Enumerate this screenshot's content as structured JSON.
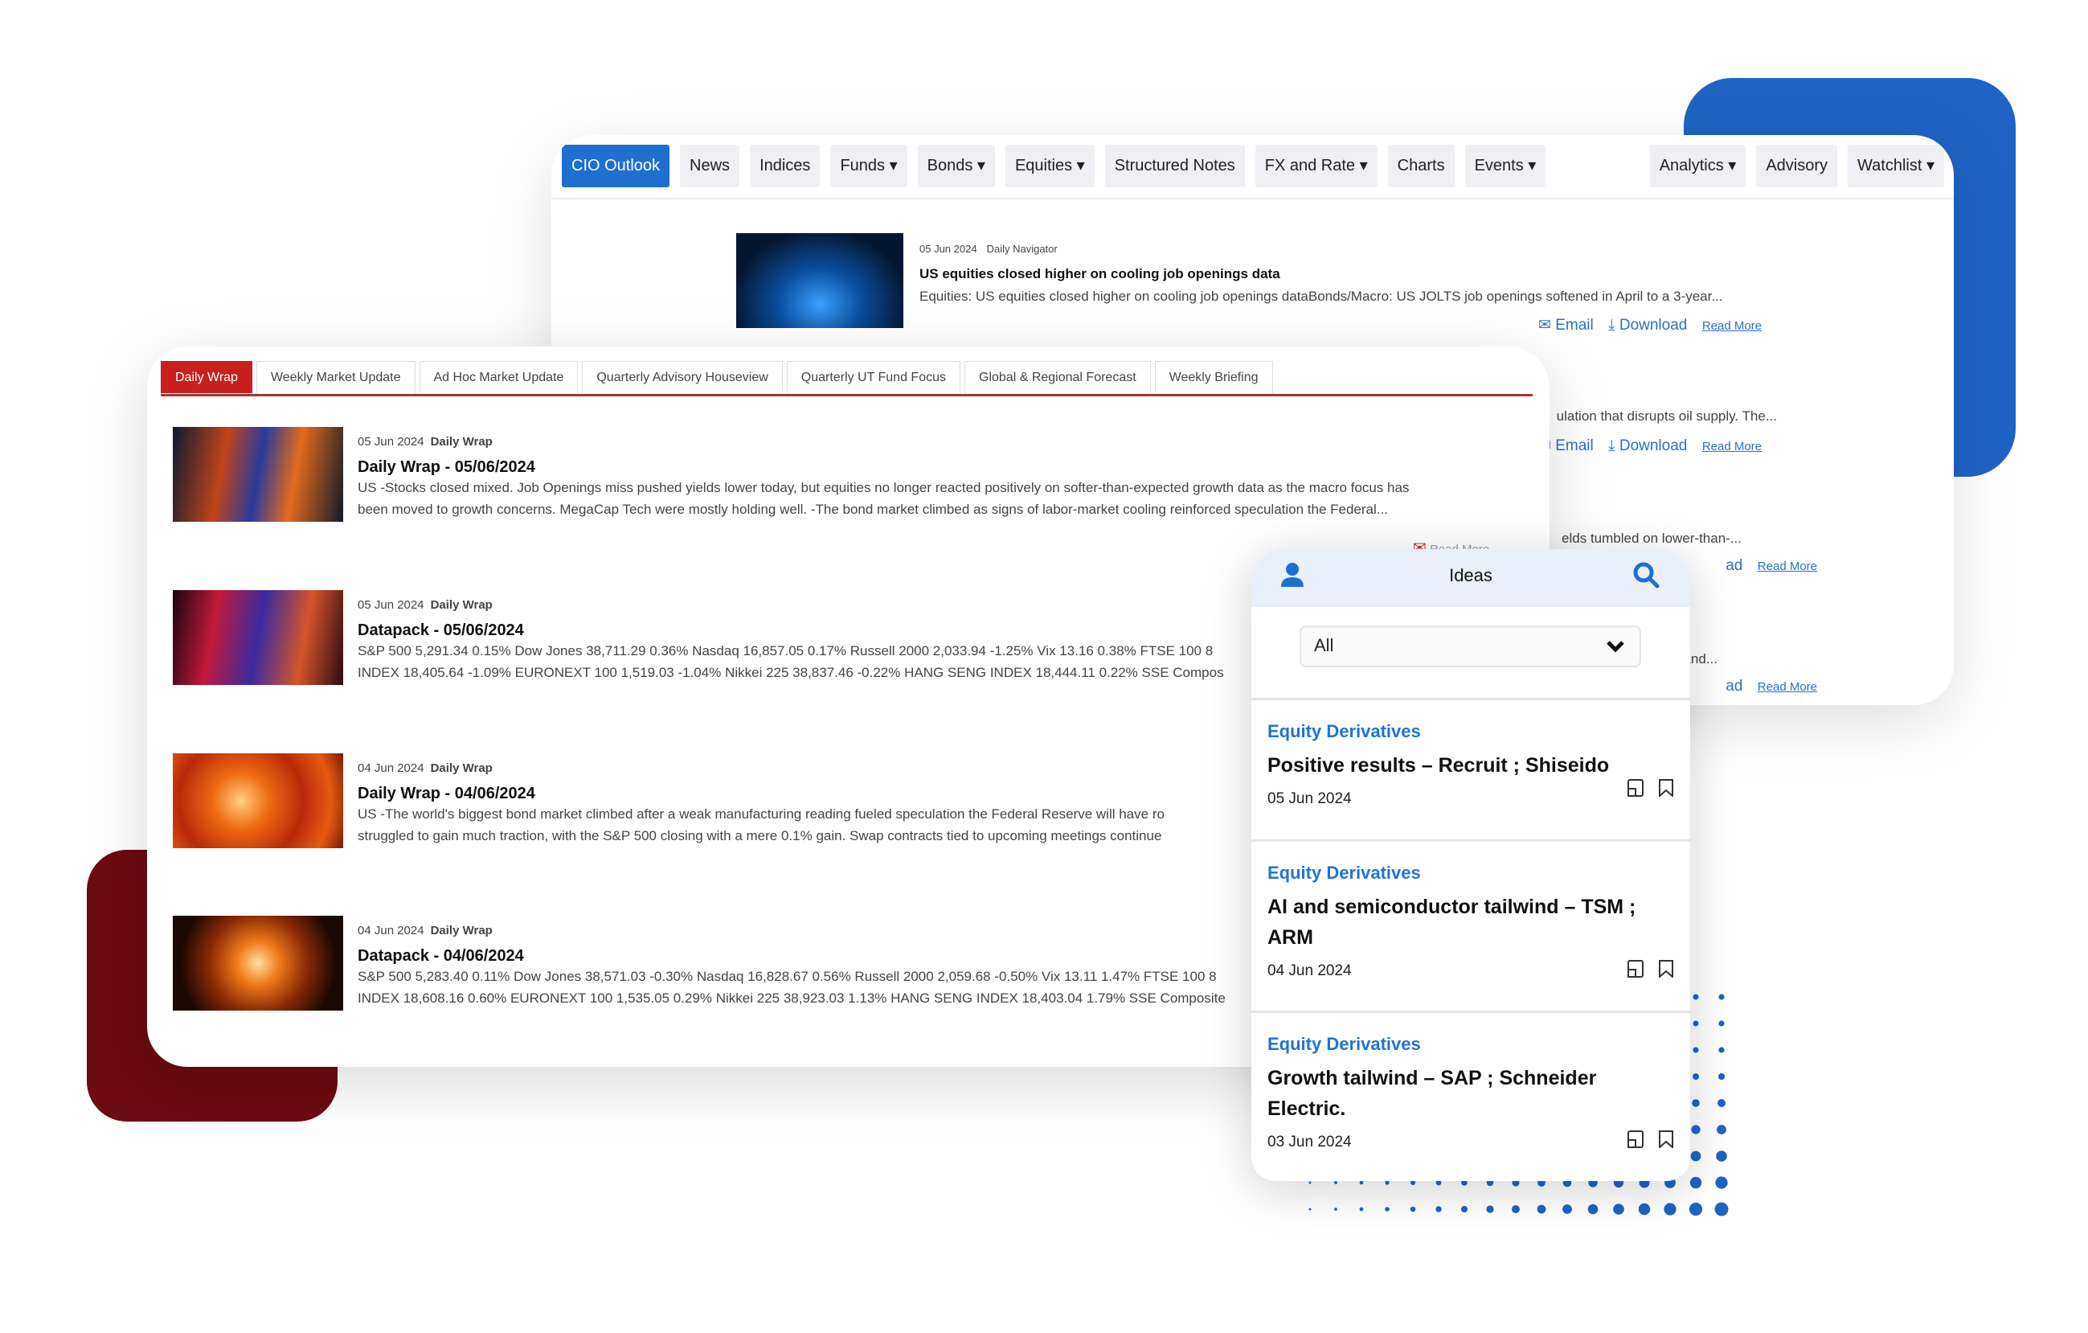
{
  "colors": {
    "accent": "#1f6fd1",
    "tab_active": "#c8201e",
    "link": "#2c6fc9",
    "deco_blue": "#1f63c4",
    "deco_red": "#6b0a12"
  },
  "nav": {
    "items": [
      "CIO Outlook",
      "News",
      "Indices",
      "Funds ▾",
      "Bonds ▾",
      "Equities ▾",
      "Structured Notes",
      "FX and Rate ▾",
      "Charts",
      "Events ▾"
    ],
    "right_items": [
      "Analytics ▾",
      "Advisory",
      "Watchlist ▾"
    ],
    "active": "CIO Outlook"
  },
  "back_article": {
    "date": "05 Jun 2024",
    "category": "Daily Navigator",
    "title": "US equities closed higher on cooling job openings data",
    "desc": "Equities: US equities closed higher on cooling job openings dataBonds/Macro: US JOLTS job openings softened in April to a 3-year...",
    "email": "Email",
    "download": "Download",
    "read_more": "Read More"
  },
  "back_fragments": [
    {
      "text": "ulation that disrupts oil supply. The...",
      "email": "Email",
      "download": "Download",
      "read_more": "Read More"
    },
    {
      "text": "elds tumbled on lower-than-...",
      "download": "ad",
      "read_more": "Read More"
    },
    {
      "text": "E and...",
      "download": "ad",
      "read_more": "Read More"
    }
  ],
  "tabs": [
    "Daily Wrap",
    "Weekly Market Update",
    "Ad Hoc Market Update",
    "Quarterly Advisory Houseview",
    "Quarterly UT Fund Focus",
    "Global & Regional Forecast",
    "Weekly Briefing"
  ],
  "articles": [
    {
      "date": "05 Jun 2024",
      "category": "Daily Wrap",
      "title": "Daily Wrap - 05/06/2024",
      "lines": [
        "US -Stocks closed mixed. Job Openings miss pushed yields lower today, but equities no longer reacted positively on softer-than-expected growth data as the macro focus has",
        "been moved to growth concerns. MegaCap Tech were mostly holding well. -The bond market climbed as signs of labor-market cooling reinforced speculation the Federal..."
      ],
      "read_more": "Read More"
    },
    {
      "date": "05 Jun 2024",
      "category": "Daily Wrap",
      "title": "Datapack - 05/06/2024",
      "lines": [
        "S&P 500 5,291.34 0.15% Dow Jones 38,711.29 0.36% Nasdaq 16,857.05 0.17% Russell 2000 2,033.94 -1.25% Vix 13.16 0.38% FTSE 100 8",
        "INDEX 18,405.64 -1.09% EURONEXT 100 1,519.03 -1.04% Nikkei 225 38,837.46 -0.22% HANG SENG INDEX 18,444.11 0.22% SSE Compos"
      ]
    },
    {
      "date": "04 Jun 2024",
      "category": "Daily Wrap",
      "title": "Daily Wrap - 04/06/2024",
      "lines": [
        "US -The world's biggest bond market climbed after a weak manufacturing reading fueled speculation the Federal Reserve will have ro",
        "struggled to gain much traction, with the S&P 500 closing with a mere 0.1% gain. Swap contracts tied to upcoming meetings continue"
      ]
    },
    {
      "date": "04 Jun 2024",
      "category": "Daily Wrap",
      "title": "Datapack - 04/06/2024",
      "lines": [
        "S&P 500 5,283.40 0.11% Dow Jones 38,571.03 -0.30% Nasdaq 16,828.67 0.56% Russell 2000 2,059.68 -0.50% Vix 13.11 1.47% FTSE 100 8",
        "INDEX 18,608.16 0.60% EURONEXT 100 1,535.05 0.29% Nikkei 225 38,923.03 1.13% HANG SENG INDEX 18,403.04 1.79% SSE Composite"
      ]
    }
  ],
  "ideas": {
    "title": "Ideas",
    "filter": "All",
    "cards": [
      {
        "category": "Equity Derivatives",
        "title": "Positive results – Recruit ; Shiseido",
        "date": "05 Jun 2024"
      },
      {
        "category": "Equity Derivatives",
        "title": "AI and semiconductor tailwind – TSM ; ARM",
        "date": "04 Jun 2024"
      },
      {
        "category": "Equity Derivatives",
        "title": "Growth tailwind – SAP ; Schneider Electric.",
        "date": "03 Jun 2024"
      }
    ]
  }
}
